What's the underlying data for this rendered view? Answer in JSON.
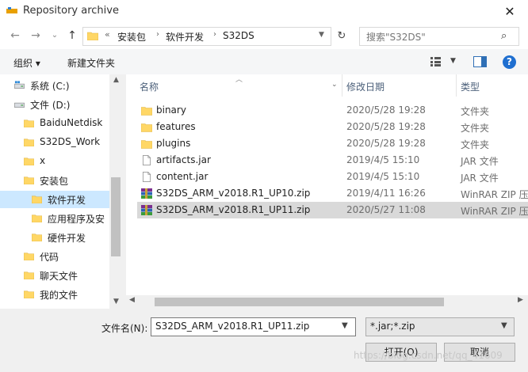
{
  "window": {
    "title": "Repository archive",
    "close_glyph": "✕"
  },
  "nav": {
    "back": "←",
    "forward": "→",
    "recent": "⌄",
    "up": "↑",
    "crumb_overflow": "«",
    "breadcrumb": [
      "安装包",
      "软件开发",
      "S32DS"
    ],
    "refresh": "↻",
    "search_placeholder": "搜索\"S32DS\"",
    "search_icon": "⌕"
  },
  "toolbar": {
    "organize": "组织 ▾",
    "new_folder": "新建文件夹",
    "help": "?"
  },
  "tree": [
    {
      "label": "系统 (C:)",
      "icon": "drive-c-icon"
    },
    {
      "label": "文件 (D:)",
      "icon": "drive-d-icon"
    },
    {
      "label": "BaiduNetdisk",
      "icon": "folder-icon"
    },
    {
      "label": "S32DS_Work",
      "icon": "folder-icon"
    },
    {
      "label": "x",
      "icon": "folder-icon"
    },
    {
      "label": "安装包",
      "icon": "folder-icon"
    },
    {
      "label": "软件开发",
      "icon": "folder-icon",
      "selected": true
    },
    {
      "label": "应用程序及安",
      "icon": "folder-icon"
    },
    {
      "label": "硬件开发",
      "icon": "folder-icon"
    },
    {
      "label": "代码",
      "icon": "folder-icon"
    },
    {
      "label": "聊天文件",
      "icon": "folder-icon"
    },
    {
      "label": "我的文件",
      "icon": "folder-icon"
    }
  ],
  "columns": {
    "name": "名称",
    "date": "修改日期",
    "type": "类型"
  },
  "files": [
    {
      "name": "binary",
      "date": "2020/5/28 19:28",
      "type": "文件夹",
      "icon": "folder-icon"
    },
    {
      "name": "features",
      "date": "2020/5/28 19:28",
      "type": "文件夹",
      "icon": "folder-icon"
    },
    {
      "name": "plugins",
      "date": "2020/5/28 19:28",
      "type": "文件夹",
      "icon": "folder-icon"
    },
    {
      "name": "artifacts.jar",
      "date": "2019/4/5 15:10",
      "type": "JAR 文件",
      "icon": "file-icon"
    },
    {
      "name": "content.jar",
      "date": "2019/4/5 15:10",
      "type": "JAR 文件",
      "icon": "file-icon"
    },
    {
      "name": "S32DS_ARM_v2018.R1_UP10.zip",
      "date": "2019/4/11 16:26",
      "type": "WinRAR ZIP 压",
      "icon": "winrar-icon"
    },
    {
      "name": "S32DS_ARM_v2018.R1_UP11.zip",
      "date": "2020/5/27 11:08",
      "type": "WinRAR ZIP 压",
      "icon": "winrar-icon",
      "selected": true
    }
  ],
  "bottom": {
    "filename_label": "文件名(N):",
    "filename_value": "S32DS_ARM_v2018.R1_UP11.zip",
    "filetype_value": "*.jar;*.zip",
    "open_button": "打开(O)",
    "cancel_button": "取消",
    "watermark": "https://blog.csdn.net/qq_41609"
  },
  "colors": {
    "accent": "#0078d7",
    "selection": "#cce8ff",
    "folder": "#ffd766"
  }
}
